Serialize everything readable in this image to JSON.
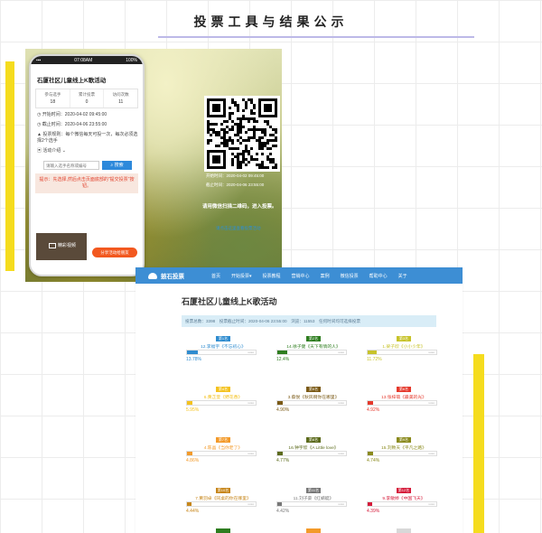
{
  "header": {
    "title": "投票工具与结果公示"
  },
  "phone": {
    "status_time": "07:08AM",
    "status_battery": "100%",
    "event_title": "石厦社区儿童线上K歌活动",
    "stats": [
      {
        "label": "参与选手",
        "value": "18"
      },
      {
        "label": "累计投票",
        "value": "0"
      },
      {
        "label": "访问次数",
        "value": "11"
      }
    ],
    "start_time": "开始时间：2020-04-02 09:45:00",
    "end_time": "截止时间：2020-04-06 23:55:00",
    "rules": "投票规则：每个微信每天可投一次，每次必须选择2个选手",
    "intro": "活动介绍",
    "search_placeholder": "请输入选手名称或编号",
    "search_button": "搜索",
    "notice": "提示：先选择,然后点击页面底部的\"提交投票\"按钮。",
    "video_label": "精彩视频",
    "orange_button": "分享活动给朋友"
  },
  "qr_panel": {
    "start": "开始时间：2020-04-02 09:45:00",
    "end": "截止时间：2020-04-06 23:55:00",
    "tip": "请用微信扫描二维码，进入投票。",
    "link": "请点击这里查看投票活动"
  },
  "site": {
    "brand": "鼓石投票",
    "nav": [
      "首页",
      "开始投票▾",
      "投票教程",
      "营销中心",
      "案例",
      "微信投票",
      "帮助中心",
      "关于"
    ],
    "page_title": "石厦社区儿童线上K歌活动",
    "infobar": "投票总数：3398　投票截止时间：2020-04-06 23:55:00　浏览：11553　任何时间均可选择投票"
  },
  "results": [
    {
      "rank": "第1名",
      "name": "12.李福宇《不忘初心》",
      "percent": 13.78,
      "label": "13.78%",
      "color": "#2f8ccf"
    },
    {
      "rank": "第2名",
      "name": "14.徐子健《天下有情的人》",
      "percent": 12.4,
      "label": "12.4%",
      "color": "#2e7d1f"
    },
    {
      "rank": "第3名",
      "name": "1.梁子欣《小小少年》",
      "percent": 11.72,
      "label": "11.72%",
      "color": "#c7c32a"
    },
    {
      "rank": "第4名",
      "name": "6.黄芷萱《野花香》",
      "percent": 5.95,
      "label": "5.95%",
      "color": "#f4c21f"
    },
    {
      "rank": "第5名",
      "name": "3.蔡悦《秋风啊你在哪里》",
      "percent": 4.9,
      "label": "4.90%",
      "color": "#7b5a16"
    },
    {
      "rank": "第6名",
      "name": "13.张梓萌《最美的光》",
      "percent": 4.92,
      "label": "4.92%",
      "color": "#e5392c"
    },
    {
      "rank": "第7名",
      "name": "4.陈晶《当你老了》",
      "percent": 4.86,
      "label": "4.86%",
      "color": "#f39a2a"
    },
    {
      "rank": "第8名",
      "name": "16.钟宇欣《A Little love》",
      "percent": 4.77,
      "label": "4.77%",
      "color": "#5c6b1c"
    },
    {
      "rank": "第9名",
      "name": "15.刘致天《平凡之路》",
      "percent": 4.74,
      "label": "4.74%",
      "color": "#8a8a1c"
    },
    {
      "rank": "第10名",
      "name": "7.黄羽卓《同桌的你在哪里》",
      "percent": 4.44,
      "label": "4.44%",
      "color": "#c7861a"
    },
    {
      "rank": "第11名",
      "name": "11.刘子豪《红蜻蜓》",
      "percent": 4.42,
      "label": "4.42%",
      "color": "#777777"
    },
    {
      "rank": "第12名",
      "name": "9.李敏婷《中国飞天》",
      "percent": 4.39,
      "label": "4.39%",
      "color": "#d51b3a"
    }
  ],
  "partial_colors": [
    "#2e7d1f",
    "#f39a2a",
    "#d8d8d8"
  ]
}
